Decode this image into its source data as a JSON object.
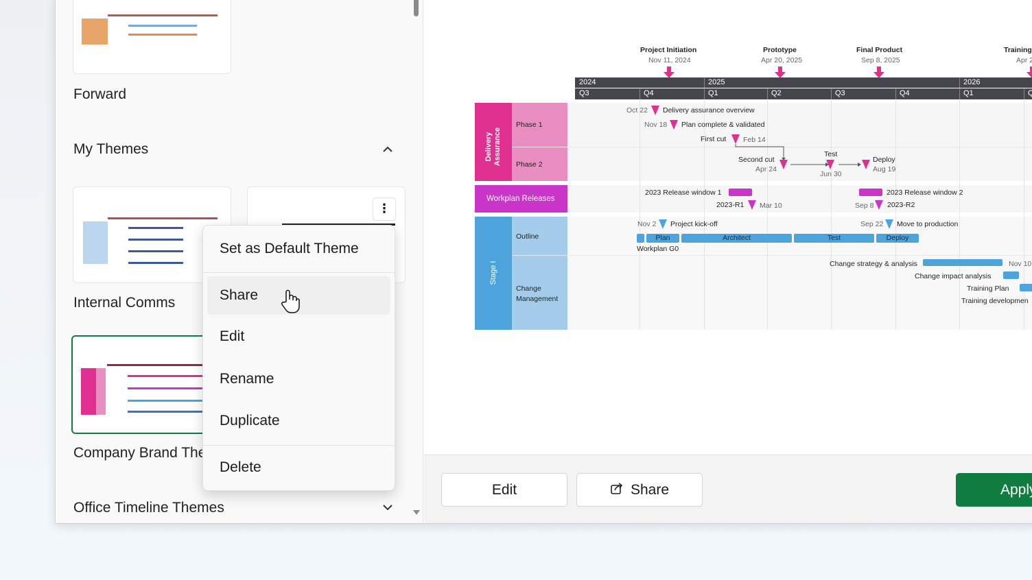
{
  "left_panel": {
    "forward_label": "Forward",
    "my_themes": {
      "title": "My Themes",
      "collapse_icon": "chevron-up-icon"
    },
    "themes": [
      {
        "name": "Internal Comms"
      },
      {
        "name": "Company Brand Theme",
        "selected": true
      }
    ],
    "office_section": {
      "title": "Office Timeline Themes",
      "expand_icon": "chevron-down-icon"
    },
    "more_button_icon": "more-vertical-icon"
  },
  "context_menu": {
    "items": [
      "Set as Default Theme",
      "Share",
      "Edit",
      "Rename",
      "Duplicate",
      "Delete"
    ],
    "hovered": "Share"
  },
  "preview": {
    "milestones_top": [
      {
        "title": "Project Initiation",
        "date": "Nov 11, 2024"
      },
      {
        "title": "Prototype",
        "date": "Apr 20, 2025"
      },
      {
        "title": "Final Product",
        "date": "Sep 8, 2025"
      },
      {
        "title": "Training",
        "date": "Apr 2"
      }
    ],
    "years": [
      "2024",
      "2025",
      "2026"
    ],
    "quarters": [
      "Q3",
      "Q4",
      "Q1",
      "Q2",
      "Q3",
      "Q4",
      "Q1",
      "Q"
    ],
    "swimlanes": {
      "delivery": {
        "group": "Delivery Assurance",
        "phase1": "Phase 1",
        "phase2": "Phase 2"
      },
      "workplan": {
        "group": "Workplan Releases"
      },
      "stage": {
        "group": "Stage I",
        "outline": "Outline",
        "change": "Change Management"
      }
    },
    "items": {
      "dao_date": "Oct 22",
      "dao": "Delivery assurance overview",
      "pcv_date": "Nov 18",
      "pcv": "Plan complete & validated",
      "fc": "First cut",
      "fc_date": "Feb 14",
      "sc": "Second cut",
      "sc_date": "Apr 24",
      "test": "Test",
      "test_date": "Jun 30",
      "deploy": "Deploy",
      "deploy_date": "Aug 19",
      "rw1": "2023 Release window 1",
      "rw2": "2023 Release window 2",
      "r1": "2023-R1",
      "r1_date": "Mar 10",
      "r2_date": "Sep 8",
      "r2": "2023-R2",
      "kick_date": "Nov 2",
      "kick": "Project kick-off",
      "mtp_date": "Sep 22",
      "mtp": "Move to production",
      "bars": [
        "Plan",
        "Architect",
        "Test",
        "Deploy"
      ],
      "wg0": "Workplan G0",
      "csa": "Change strategy & analysis",
      "csa_date": "Nov 10",
      "cia": "Change impact analysis",
      "tp": "Training Plan",
      "td": "Training developmen"
    },
    "colors": {
      "delivery": "#e0308f",
      "delivery_light": "#ea8ec2",
      "workplan": "#c934c9",
      "stage": "#4da3db",
      "stage_light": "#a3cdeb",
      "timeband": "#45454d"
    }
  },
  "footer": {
    "edit": "Edit",
    "share": "Share",
    "share_icon": "share-icon",
    "apply": "Apply",
    "apply_color": "#107c3f"
  }
}
